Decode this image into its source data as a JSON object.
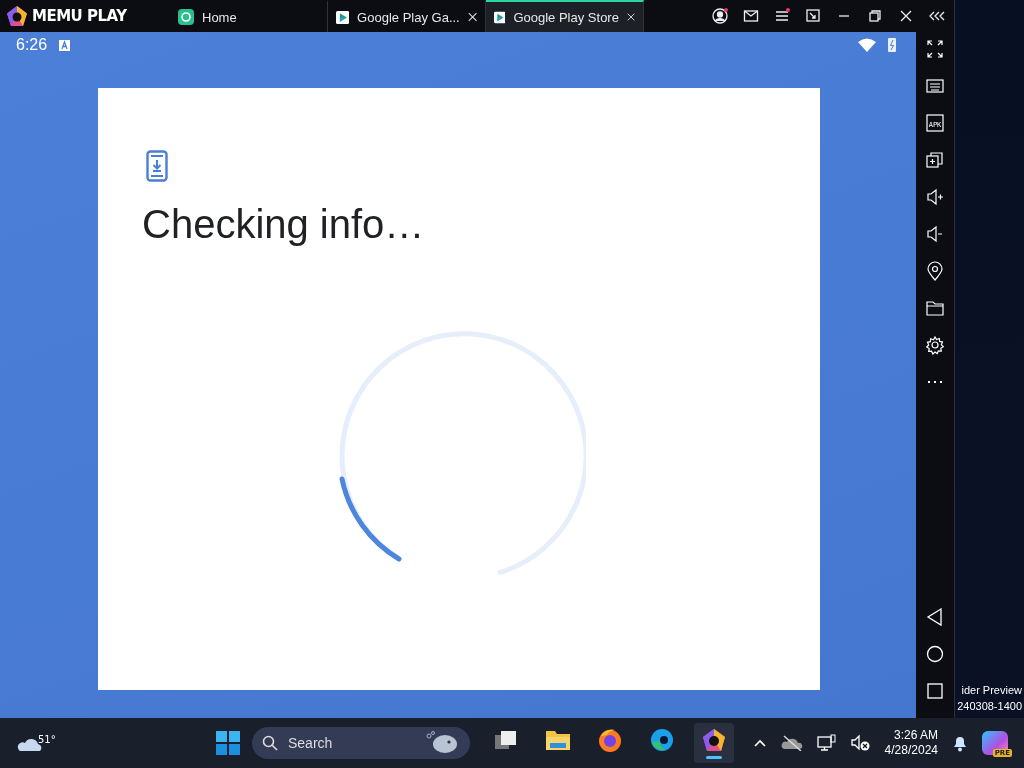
{
  "app": {
    "logo": "MEMU PLAY"
  },
  "tabs": [
    {
      "label": "Home",
      "kind": "home",
      "closable": false,
      "selected": false
    },
    {
      "label": "Google Play Ga...",
      "kind": "play",
      "closable": true,
      "selected": false
    },
    {
      "label": "Google Play Store",
      "kind": "play",
      "closable": true,
      "selected": true
    }
  ],
  "toolbar": [
    {
      "kind": "account",
      "badge": true
    },
    {
      "kind": "mail",
      "badge": false
    },
    {
      "kind": "menu",
      "badge": true
    },
    {
      "kind": "screenshot",
      "badge": false
    },
    {
      "kind": "minimize",
      "badge": false
    },
    {
      "kind": "restore",
      "badge": false
    },
    {
      "kind": "close",
      "badge": false
    },
    {
      "kind": "collapse",
      "badge": false
    }
  ],
  "status_bar": {
    "time": "6:26"
  },
  "dialog": {
    "title": "Checking info…"
  },
  "sidebar": [
    {
      "kind": "fullscreen"
    },
    {
      "kind": "keyboard"
    },
    {
      "kind": "apk",
      "label": "APK"
    },
    {
      "kind": "multi"
    },
    {
      "kind": "volup"
    },
    {
      "kind": "voldown"
    },
    {
      "kind": "location"
    },
    {
      "kind": "folder"
    },
    {
      "kind": "settings"
    },
    {
      "kind": "more"
    }
  ],
  "nav": [
    {
      "kind": "back"
    },
    {
      "kind": "home"
    },
    {
      "kind": "recents"
    }
  ],
  "desktop": {
    "lines": [
      "ider Preview",
      "240308-1400"
    ]
  },
  "taskbar": {
    "weather": "51°",
    "search": {
      "placeholder": "Search"
    },
    "apps": [
      {
        "kind": "taskview",
        "selected": false
      },
      {
        "kind": "files",
        "selected": false
      },
      {
        "kind": "firefox",
        "selected": false
      },
      {
        "kind": "edge",
        "selected": false
      },
      {
        "kind": "memu",
        "selected": true
      }
    ],
    "time": "3:26 AM",
    "date": "4/28/2024",
    "copilot_badge": "PRE"
  }
}
